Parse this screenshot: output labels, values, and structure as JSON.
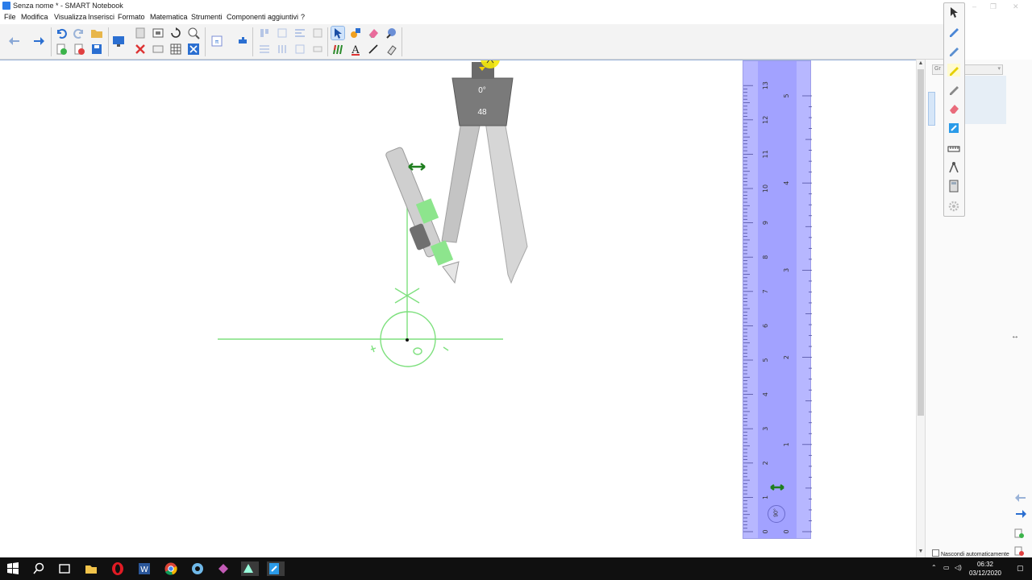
{
  "window": {
    "title": "Senza nome * - SMART Notebook"
  },
  "menu": [
    "File",
    "Modifica",
    "Visualizza",
    "Inserisci",
    "Formato",
    "Matematica",
    "Strumenti",
    "Componenti aggiuntivi",
    "?"
  ],
  "toolbar_icons": [
    "back-arrow",
    "forward-arrow",
    "undo",
    "redo",
    "open-folder",
    "add-page",
    "delete-page",
    "save",
    "screen-shade",
    "paste",
    "delete",
    "capture",
    "table",
    "rotate",
    "zoom",
    "dual-page",
    "insert-object",
    "align",
    "select",
    "shapes",
    "eraser",
    "magic-pen",
    "pens",
    "text",
    "line",
    "fill",
    "properties"
  ],
  "compass": {
    "angle": "0°",
    "value": "48"
  },
  "ruler": {
    "cm_labels": [
      "0",
      "1",
      "2",
      "3",
      "4",
      "5",
      "6",
      "7",
      "8",
      "9",
      "10",
      "11",
      "12",
      "13"
    ],
    "inch_labels": [
      "0",
      "1",
      "2",
      "3",
      "4",
      "5"
    ],
    "angle_badge": "90°"
  },
  "pen_tray_icons": [
    "select-arrow",
    "pen",
    "pen-alt",
    "highlighter",
    "creative-pen",
    "eraser",
    "magic-pen",
    "ruler",
    "compass",
    "calculator",
    "settings"
  ],
  "side_pane": {
    "dropdown_label": "Gr",
    "autohide_label": "Nascondi automaticamente"
  },
  "taskbar": {
    "apps": [
      "start",
      "search",
      "task-view",
      "file-explorer",
      "opera",
      "word",
      "chrome",
      "app-blue",
      "app-pink",
      "app-geo",
      "smart-notebook"
    ],
    "time": "06:32",
    "date": "03/12/2020"
  },
  "colors": {
    "construction": "#7ee07e",
    "ruler": "#b7b7ff",
    "highlight": "#f5e90a",
    "accent": "#2b7de9"
  }
}
